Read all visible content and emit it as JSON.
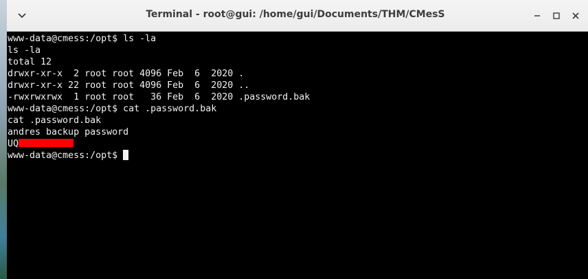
{
  "window": {
    "title": "Terminal - root@gui: /home/gui/Documents/THM/CMesS"
  },
  "terminal": {
    "lines": [
      "www-data@cmess:/opt$ ls -la",
      "ls -la",
      "total 12",
      "drwxr-xr-x  2 root root 4096 Feb  6  2020 .",
      "drwxr-xr-x 22 root root 4096 Feb  6  2020 ..",
      "-rwxrwxrwx  1 root root   36 Feb  6  2020 .password.bak",
      "www-data@cmess:/opt$ cat .password.bak",
      "cat .password.bak",
      "andres backup password"
    ],
    "redacted_prefix": "UQ",
    "prompt": "www-data@cmess:/opt$ ",
    "redaction_color": "#ff0000"
  },
  "icons": {
    "menu": "chevron-down-icon",
    "minimize": "minimize-icon",
    "maximize": "maximize-icon",
    "close": "close-icon"
  }
}
